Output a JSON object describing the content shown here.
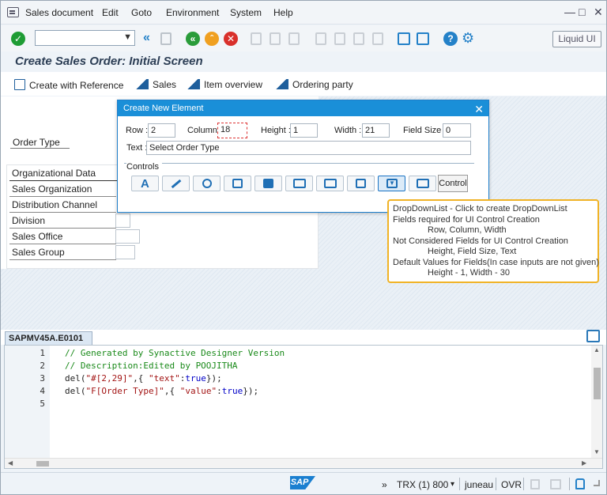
{
  "menu": {
    "items": [
      "Sales document",
      "Edit",
      "Goto",
      "Environment",
      "System",
      "Help"
    ],
    "window_controls": {
      "minimize": "—",
      "maximize": "□",
      "close": "✕"
    }
  },
  "toolbar": {
    "command_field_value": "",
    "liquid_ui_label": "Liquid UI",
    "colors": {
      "enter": "#1e9c34",
      "back": "#2a9c3a",
      "exit": "#f0a020",
      "cancel": "#d9302b",
      "help": "#2481c8"
    }
  },
  "page": {
    "title": "Create Sales Order: Initial Screen"
  },
  "app_toolbar": {
    "buttons": [
      "Create with Reference",
      "Sales",
      "Item overview",
      "Ordering party"
    ]
  },
  "form": {
    "order_type_label": "Order Type",
    "org_header": "Organizational Data",
    "org_fields": [
      "Sales Organization",
      "Distribution Channel",
      "Division",
      "Sales Office",
      "Sales Group"
    ]
  },
  "dialog": {
    "title": "Create New Element",
    "close_glyph": "✕",
    "row_label": "Row :",
    "row_value": "2",
    "column_label": "Column :",
    "column_value": "18",
    "height_label": "Height :",
    "height_value": "1",
    "width_label": "Width :",
    "width_value": "21",
    "fieldsize_label": "Field Size :",
    "fieldsize_value": "0",
    "text_label": "Text :",
    "text_value": "Select Order Type",
    "controls_label": "Controls",
    "control_button_label": "Control"
  },
  "tooltip": {
    "lines": [
      "DropDownList - Click to create DropDownList",
      "Fields required for UI Control Creation",
      "Row, Column, Width",
      "Not Considered Fields for UI Control Creation",
      "Height, Field Size, Text",
      "Default Values for Fields(In case inputs are not given)",
      "Height - 1, Width - 30"
    ]
  },
  "editor": {
    "tab_label": "SAPMV45A.E0101",
    "line_numbers": [
      "1",
      "2",
      "3",
      "4",
      "5"
    ],
    "code": [
      "// Generated by Synactive Designer Version",
      "// Description:Edited by POOJITHA",
      "del(\"#[2,29]\",{ \"text\":true});",
      "del(\"F[Order Type]\",{ \"value\":true});",
      ""
    ]
  },
  "status": {
    "sap_logo": "SAP",
    "more": "»",
    "system": "TRX (1) 800",
    "dropdown_glyph": "▾",
    "user": "juneau",
    "mode": "OVR"
  }
}
